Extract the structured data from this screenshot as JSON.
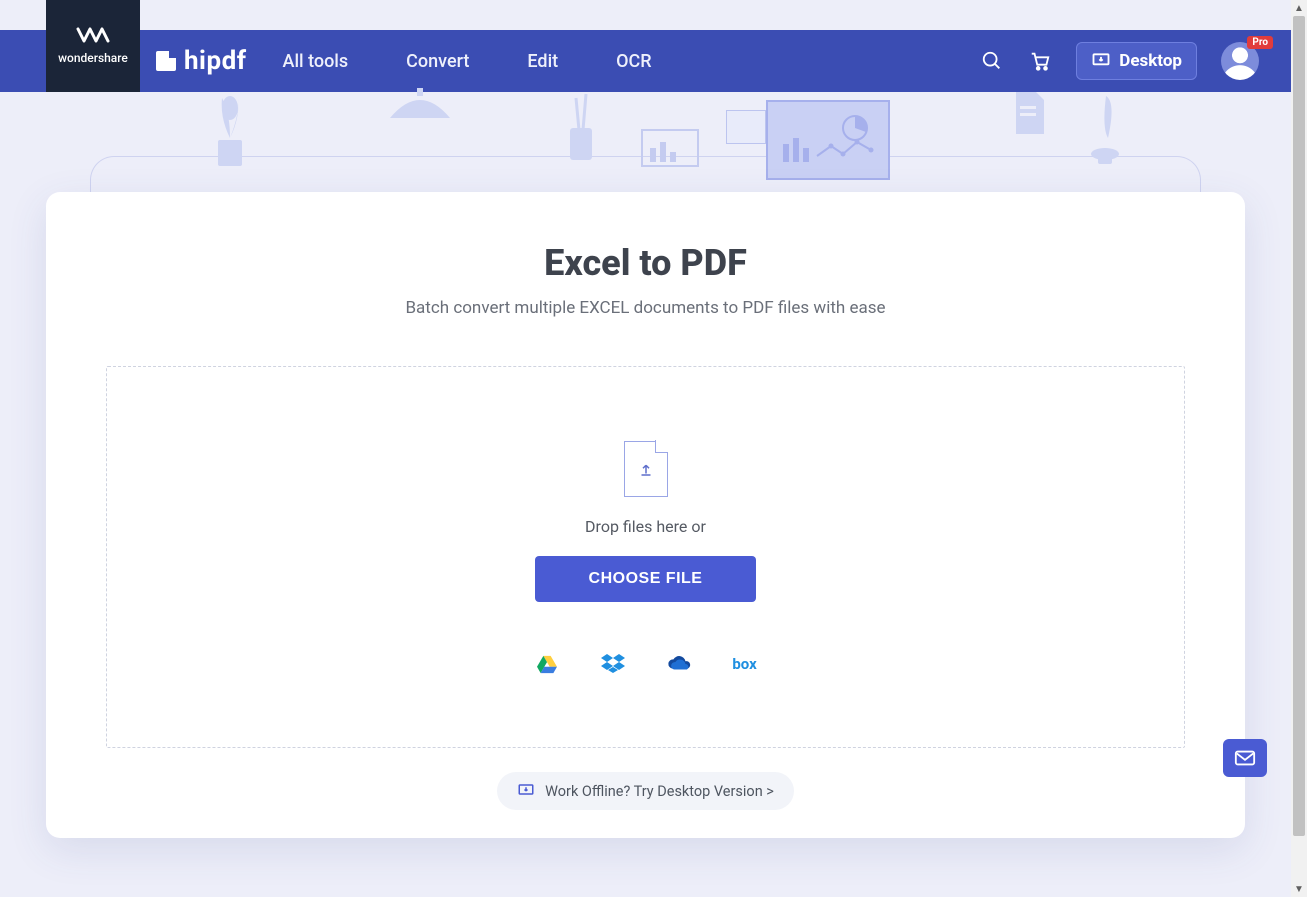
{
  "brand": {
    "parent": "wondershare",
    "product": "hipdf"
  },
  "nav": {
    "items": [
      "All tools",
      "Convert",
      "Edit",
      "OCR"
    ],
    "desktop_label": "Desktop",
    "pro_badge": "Pro"
  },
  "main": {
    "title": "Excel to PDF",
    "subtitle": "Batch convert multiple EXCEL documents to PDF files with ease",
    "drop_text": "Drop files here or",
    "choose_label": "CHOOSE FILE",
    "providers": {
      "box_label": "box"
    },
    "offline_label": "Work Offline? Try Desktop Version >"
  }
}
